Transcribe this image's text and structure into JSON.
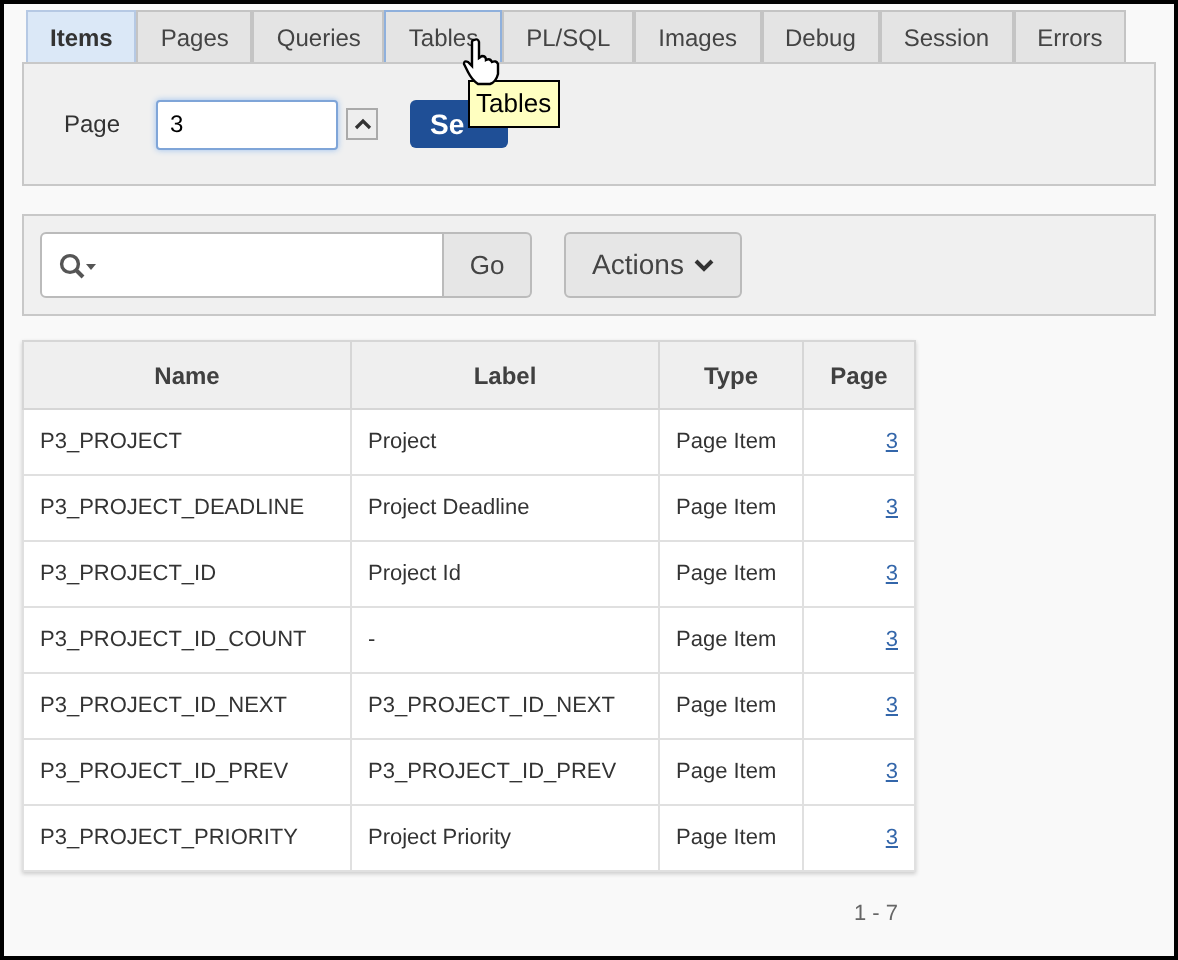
{
  "tabs": [
    {
      "label": "Items",
      "selected": true,
      "hovered": false
    },
    {
      "label": "Pages",
      "selected": false,
      "hovered": false
    },
    {
      "label": "Queries",
      "selected": false,
      "hovered": false
    },
    {
      "label": "Tables",
      "selected": false,
      "hovered": true
    },
    {
      "label": "PL/SQL",
      "selected": false,
      "hovered": false
    },
    {
      "label": "Images",
      "selected": false,
      "hovered": false
    },
    {
      "label": "Debug",
      "selected": false,
      "hovered": false
    },
    {
      "label": "Session",
      "selected": false,
      "hovered": false
    },
    {
      "label": "Errors",
      "selected": false,
      "hovered": false
    }
  ],
  "page_form": {
    "label": "Page",
    "value": "3",
    "button": "Se"
  },
  "tooltip": "Tables",
  "search": {
    "go": "Go",
    "actions": "Actions"
  },
  "table": {
    "columns": [
      "Name",
      "Label",
      "Type",
      "Page"
    ],
    "rows": [
      [
        "P3_PROJECT",
        "Project",
        "Page Item",
        "3"
      ],
      [
        "P3_PROJECT_DEADLINE",
        "Project Deadline",
        "Page Item",
        "3"
      ],
      [
        "P3_PROJECT_ID",
        "Project Id",
        "Page Item",
        "3"
      ],
      [
        "P3_PROJECT_ID_COUNT",
        "-",
        "Page Item",
        "3"
      ],
      [
        "P3_PROJECT_ID_NEXT",
        "P3_PROJECT_ID_NEXT",
        "Page Item",
        "3"
      ],
      [
        "P3_PROJECT_ID_PREV",
        "P3_PROJECT_ID_PREV",
        "Page Item",
        "3"
      ],
      [
        "P3_PROJECT_PRIORITY",
        "Project Priority",
        "Page Item",
        "3"
      ]
    ]
  },
  "pagination": "1 - 7"
}
